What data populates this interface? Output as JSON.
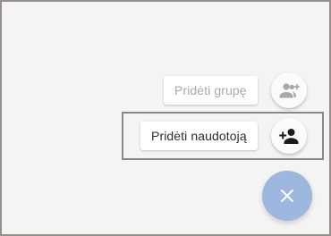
{
  "speed_dial": {
    "actions": [
      {
        "label": "Pridėti grupę",
        "icon": "group-add-icon",
        "state": "muted"
      },
      {
        "label": "Pridėti naudotoją",
        "icon": "person-add-icon",
        "state": "active"
      }
    ],
    "main_button_icon": "close-icon"
  },
  "colors": {
    "background": "#f5f4f4",
    "fab_main": "#9db7de",
    "muted_text": "#a8a8a8",
    "active_text": "#2d2d2d"
  }
}
